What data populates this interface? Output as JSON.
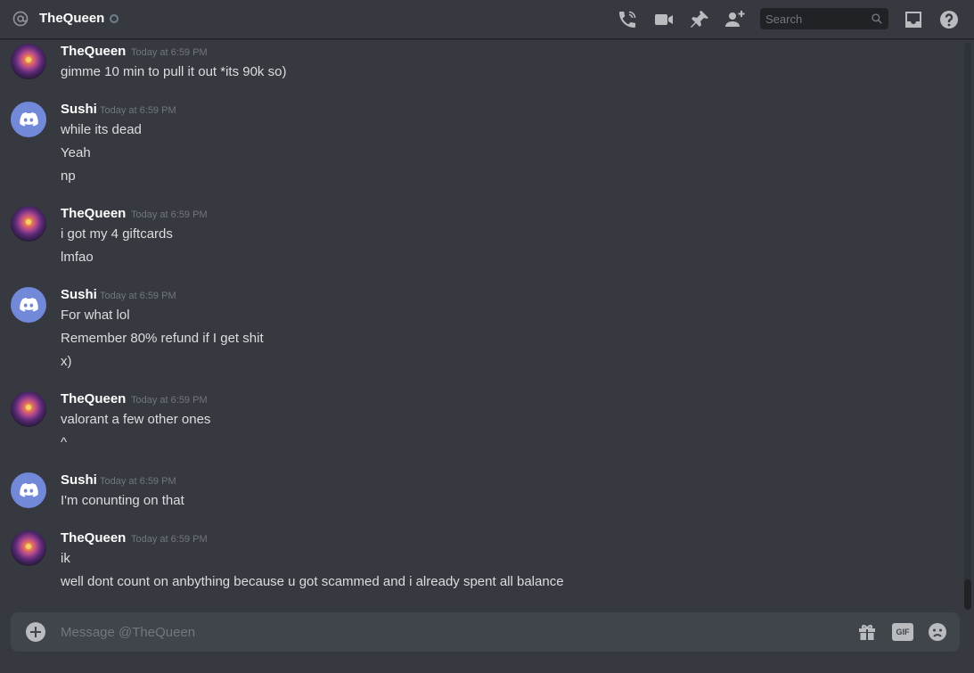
{
  "header": {
    "title": "TheQueen",
    "search_placeholder": "Search",
    "icons": [
      "at-icon",
      "status-offline-icon",
      "phone-call-icon",
      "video-call-icon",
      "pin-icon",
      "add-friend-icon",
      "search-icon",
      "inbox-icon",
      "help-icon"
    ]
  },
  "messages": [
    {
      "author": "TheQueen",
      "avatar": "queen",
      "timestamp": "Today at 6:59 PM",
      "lines": [
        "gimme 10 min to pull it out *its 90k so)"
      ]
    },
    {
      "author": "Sushi",
      "avatar": "discord",
      "timestamp": "Today at 6:59 PM",
      "lines": [
        "while its dead",
        "Yeah",
        "np"
      ]
    },
    {
      "author": "TheQueen",
      "avatar": "queen",
      "timestamp": "Today at 6:59 PM",
      "lines": [
        "i got my 4 giftcards",
        "lmfao"
      ]
    },
    {
      "author": "Sushi",
      "avatar": "discord",
      "timestamp": "Today at 6:59 PM",
      "lines": [
        "For what lol",
        "Remember 80% refund if I get shit",
        "x)"
      ]
    },
    {
      "author": "TheQueen",
      "avatar": "queen",
      "timestamp": "Today at 6:59 PM",
      "lines": [
        "valorant a few other ones",
        "^"
      ]
    },
    {
      "author": "Sushi",
      "avatar": "discord",
      "timestamp": "Today at 6:59 PM",
      "lines": [
        "I'm conunting on that"
      ]
    },
    {
      "author": "TheQueen",
      "avatar": "queen",
      "timestamp": "Today at 6:59 PM",
      "lines": [
        "ik",
        "well dont count on anbything because u got scammed and i already spent all balance"
      ]
    }
  ],
  "composer": {
    "placeholder": "Message @TheQueen",
    "gif_label": "GIF",
    "icons": [
      "add-attachment-icon",
      "gift-icon",
      "gif-icon",
      "emoji-icon"
    ]
  },
  "colors": {
    "background": "#36393f",
    "header_border": "#202225",
    "input_background": "#40444b",
    "username": "#ffffff",
    "text": "#dcddde",
    "timestamp": "#72767d",
    "discord_blurple": "#7289da"
  }
}
